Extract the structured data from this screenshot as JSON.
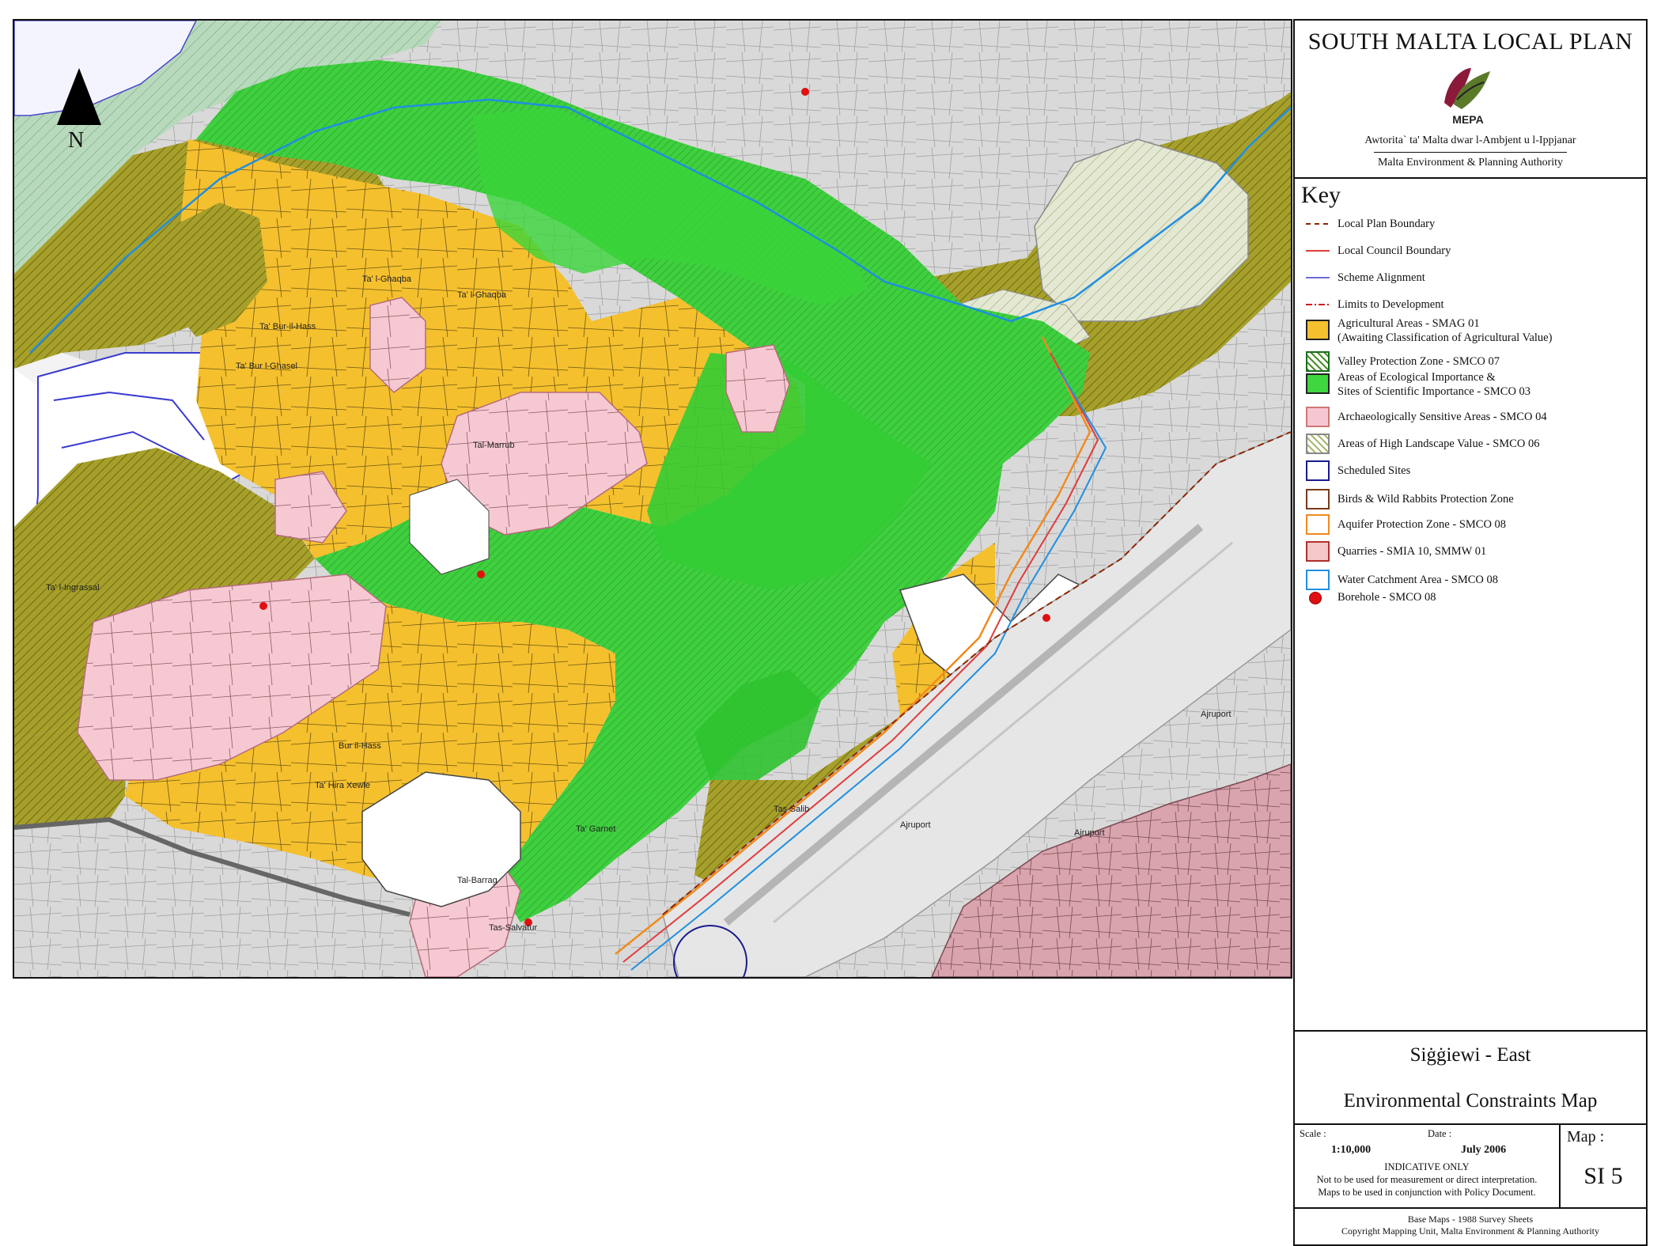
{
  "header": {
    "plan_title": "SOUTH MALTA LOCAL PLAN",
    "logo_text": "MEPA",
    "authority_maltese": "Awtorita` ta' Malta dwar l-Ambjent u l-Ippjanar",
    "authority_english": "Malta Environment & Planning Authority"
  },
  "map": {
    "north_label": "N",
    "place_labels": [
      "Ta' l-Ghaqba",
      "Ta' l-Ghaqba",
      "Ta' Bur-il-Hass",
      "Ta' Bur l-Ghasel",
      "Ta' l-Ingrassal",
      "Tal-Marrub",
      "Bur il-Hass",
      "Ta' Hira Xewle",
      "Tal-Barrag",
      "Tas-Salvatur",
      "Ta' Garnet",
      "Ajruport",
      "Ajruport",
      "Ajruport",
      "Tas-Salib"
    ]
  },
  "key": {
    "title": "Key",
    "items": [
      {
        "label": "Local Plan Boundary",
        "kind": "line",
        "color": "#8b2500",
        "dash": "6,5"
      },
      {
        "label": "Local Council Boundary",
        "kind": "line",
        "color": "#e03c3c",
        "dash": ""
      },
      {
        "label": "Scheme Alignment",
        "kind": "line",
        "color": "#6b6bd6",
        "dash": ""
      },
      {
        "label": "Limits to Development",
        "kind": "line",
        "color": "#d11a1a",
        "dash": "8,3,2,3"
      },
      {
        "label": "Agricultural Areas - SMAG 01\n(Awaiting Classification of Agricultural Value)",
        "kind": "fill",
        "color": "#f5c02e",
        "border": "#222"
      },
      {
        "label": "Valley Protection Zone - SMCO 07",
        "kind": "hatch",
        "color": "#4c8f2a",
        "border": "#1a6e1a"
      },
      {
        "label": "Areas of Ecological Importance &\nSites of Scientific Importance - SMCO 03",
        "kind": "fill",
        "color": "#3fd63f",
        "border": "#222"
      },
      {
        "label": "Archaeologically Sensitive Areas - SMCO 04",
        "kind": "fill",
        "color": "#f7c6d3",
        "border": "#c77"
      },
      {
        "label": "Areas of High Landscape Value - SMCO 06",
        "kind": "hatch",
        "color": "#a8b870",
        "border": "#888"
      },
      {
        "label": "Scheduled Sites",
        "kind": "outline",
        "color": "#1a1a8f",
        "border": "#1a1a8f"
      },
      {
        "label": "Birds & Wild Rabbits Protection Zone",
        "kind": "outline",
        "color": "#7a3b1b",
        "border": "#7a3b1b"
      },
      {
        "label": "Aquifer Protection Zone - SMCO 08",
        "kind": "outline",
        "color": "#f08a1e",
        "border": "#f08a1e"
      },
      {
        "label": "Quarries - SMIA 10, SMMW 01",
        "kind": "fill",
        "color": "#f4c8c8",
        "border": "#b03030"
      },
      {
        "label": "Water Catchment Area - SMCO 08",
        "kind": "outline",
        "color": "#1f8fe0",
        "border": "#1f8fe0"
      },
      {
        "label": "Borehole - SMCO 08",
        "kind": "dot",
        "color": "#e01010",
        "border": "#900"
      }
    ]
  },
  "info": {
    "place": "Siġġiewi - East",
    "map_name": "Environmental Constraints Map",
    "scale_label": "Scale :",
    "scale_value": "1:10,000",
    "date_label": "Date :",
    "date_value": "July 2006",
    "indicative": "INDICATIVE ONLY",
    "note1": "Not to be used for measurement or direct interpretation.",
    "note2": "Maps to be used in conjunction with Policy Document.",
    "map_label": "Map :",
    "map_number": "SI 5",
    "footer1": "Base Maps - 1988 Survey Sheets",
    "footer2": "Copyright Mapping Unit, Malta Environment & Planning Authority"
  }
}
